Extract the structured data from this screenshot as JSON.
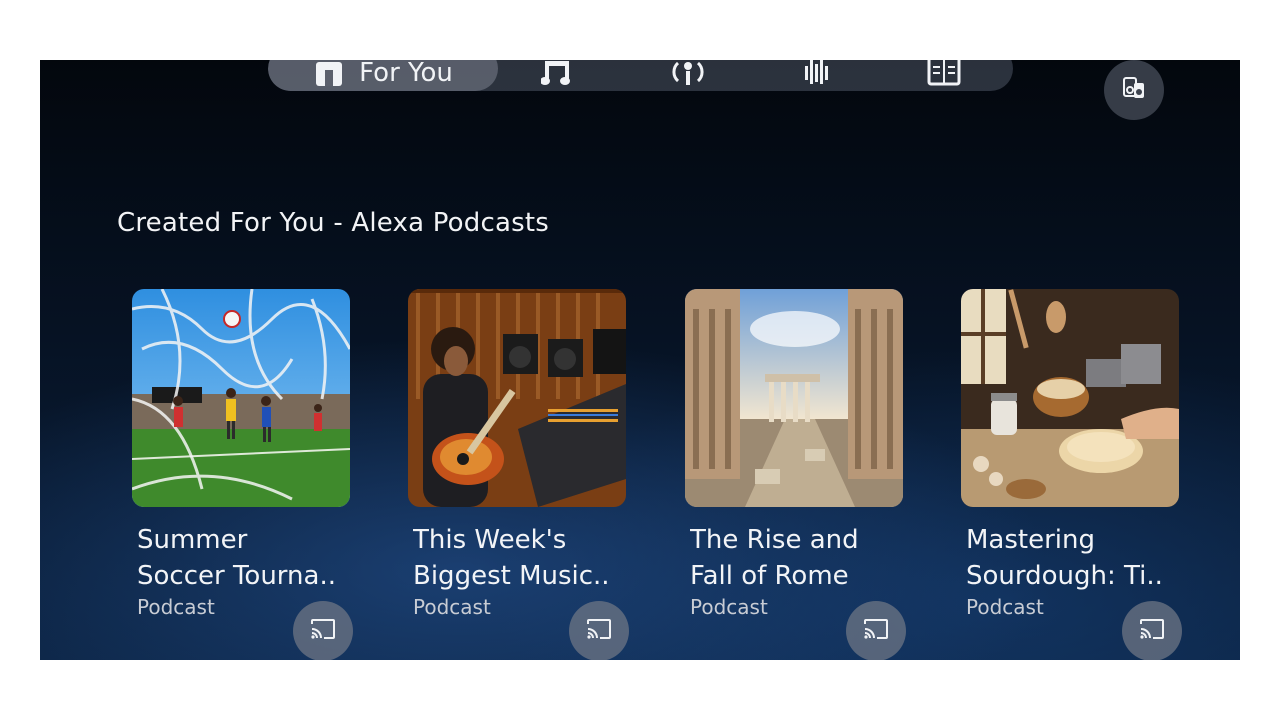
{
  "nav": {
    "for_you_label": "For You",
    "items": [
      {
        "name": "for-you",
        "icon": "home-icon"
      },
      {
        "name": "music",
        "icon": "music-note-icon"
      },
      {
        "name": "podcasts",
        "icon": "podcast-microphone-icon"
      },
      {
        "name": "audio",
        "icon": "soundwave-icon"
      },
      {
        "name": "books",
        "icon": "book-icon"
      }
    ]
  },
  "corner_button": {
    "icon": "speaker-icon"
  },
  "section": {
    "title": "Created For You - Alexa Podcasts"
  },
  "cards": [
    {
      "line1": "Summer",
      "line2": "Soccer Tourna..",
      "subtitle": "Podcast",
      "image": "soccer-match-image"
    },
    {
      "line1": "This Week's",
      "line2": "Biggest Music..",
      "subtitle": "Podcast",
      "image": "guitarist-studio-image"
    },
    {
      "line1": "The Rise and",
      "line2": "Fall of Rome",
      "subtitle": "Podcast",
      "image": "roman-ruins-image"
    },
    {
      "line1": "Mastering",
      "line2": "Sourdough: Ti..",
      "subtitle": "Podcast",
      "image": "bread-baking-image"
    }
  ],
  "colors": {
    "accent": "#f1f3f6",
    "background": "#061223"
  }
}
